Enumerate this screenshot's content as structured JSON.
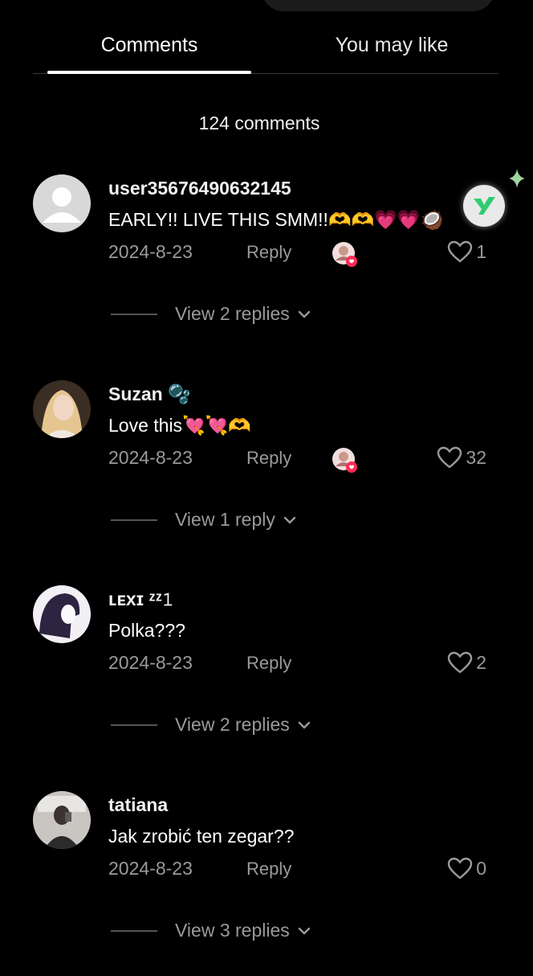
{
  "tabs": [
    {
      "label": "Comments",
      "active": true
    },
    {
      "label": "You may like",
      "active": false
    }
  ],
  "comment_count": "124 comments",
  "comments": [
    {
      "username": "user35676490632145",
      "text": "EARLY!! LIVE THIS SMM!!🫶🫶💗💗🥥",
      "date": "2024-8-23",
      "reply_label": "Reply",
      "likes": "1",
      "creator_liked": true,
      "view_replies": "View 2 replies"
    },
    {
      "username": "Suzan 🫧",
      "text": "Love this💘💘🫶",
      "date": "2024-8-23",
      "reply_label": "Reply",
      "likes": "32",
      "creator_liked": true,
      "view_replies": "View 1 reply"
    },
    {
      "username": "ʟᴇxɪ ᶻᶻ𝟷",
      "text": "Polka???",
      "date": "2024-8-23",
      "reply_label": "Reply",
      "likes": "2",
      "creator_liked": false,
      "view_replies": "View 2 replies"
    },
    {
      "username": "tatiana",
      "text": "Jak zrobić ten zegar??",
      "date": "2024-8-23",
      "reply_label": "Reply",
      "likes": "0",
      "creator_liked": false,
      "view_replies": "View 3 replies"
    }
  ],
  "colors": {
    "background": "#000000",
    "muted_text": "#9a9a9a",
    "heart_badge": "#fe2c55",
    "floating_logo": "#2ecc71"
  }
}
